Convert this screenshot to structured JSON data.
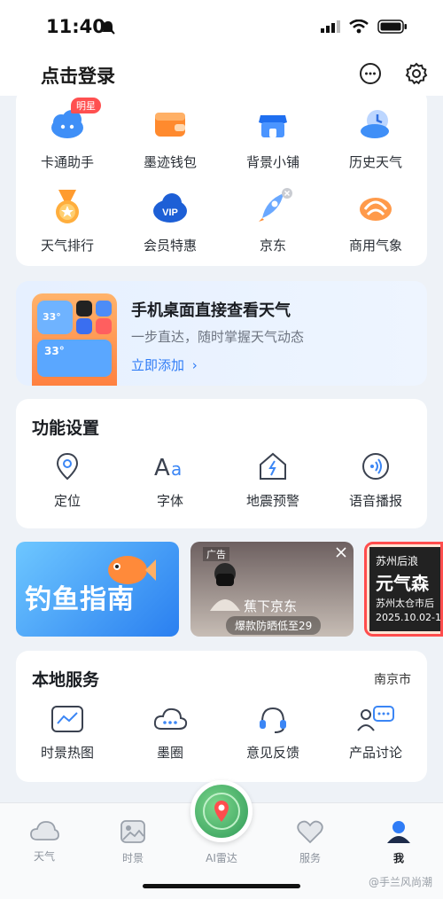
{
  "status": {
    "time": "11:40"
  },
  "header": {
    "login_label": "点击登录"
  },
  "tools": {
    "row1": [
      {
        "label": "卡通助手",
        "icon": "cartoon-assistant-icon",
        "badge": "明星"
      },
      {
        "label": "墨迹钱包",
        "icon": "wallet-icon"
      },
      {
        "label": "背景小铺",
        "icon": "shop-icon"
      },
      {
        "label": "历史天气",
        "icon": "history-weather-icon"
      }
    ],
    "row2": [
      {
        "label": "天气排行",
        "icon": "ranking-medal-icon"
      },
      {
        "label": "会员特惠",
        "icon": "vip-icon"
      },
      {
        "label": "京东",
        "icon": "jd-rocket-icon"
      },
      {
        "label": "商用气象",
        "icon": "commercial-weather-icon"
      }
    ]
  },
  "promo": {
    "title": "手机桌面直接查看天气",
    "subtitle": "一步直达，随时掌握天气动态",
    "link": "立即添加",
    "widget_temp1": "33°",
    "widget_temp2": "33°"
  },
  "function_settings": {
    "title": "功能设置",
    "items": [
      {
        "label": "定位",
        "icon": "location-pin-icon"
      },
      {
        "label": "字体",
        "icon": "font-aa-icon"
      },
      {
        "label": "地震预警",
        "icon": "earthquake-warning-icon"
      },
      {
        "label": "语音播报",
        "icon": "voice-broadcast-icon"
      }
    ]
  },
  "banners": {
    "fishing": "钓鱼指南",
    "jd_ad_tag": "广告",
    "jd_title": "蕉下京东",
    "jd_sub": "爆款防晒低至29",
    "suzhou_line1": "苏州后浪",
    "suzhou_line2": "元气森",
    "suzhou_line3": "苏州太仓市后",
    "suzhou_line4": "2025.10.02-1"
  },
  "local_services": {
    "title": "本地服务",
    "city": "南京市",
    "items": [
      {
        "label": "时景热图",
        "icon": "heatmap-icon"
      },
      {
        "label": "墨圈",
        "icon": "cloud-circle-icon"
      },
      {
        "label": "意见反馈",
        "icon": "feedback-headset-icon"
      },
      {
        "label": "产品讨论",
        "icon": "discussion-icon"
      }
    ]
  },
  "tabbar": {
    "items": [
      {
        "label": "天气",
        "icon": "weather-cloud-icon"
      },
      {
        "label": "时景",
        "icon": "photo-icon"
      },
      {
        "label": "AI雷达",
        "icon": "ai-radar-icon"
      },
      {
        "label": "服务",
        "icon": "service-heart-icon"
      },
      {
        "label": "我",
        "icon": "person-icon"
      }
    ],
    "active": "我"
  },
  "watermark": "@手兰风尚潮",
  "colors": {
    "accent": "#2f7cf6",
    "badge": "#ff5050",
    "background": "#eef2f7"
  }
}
